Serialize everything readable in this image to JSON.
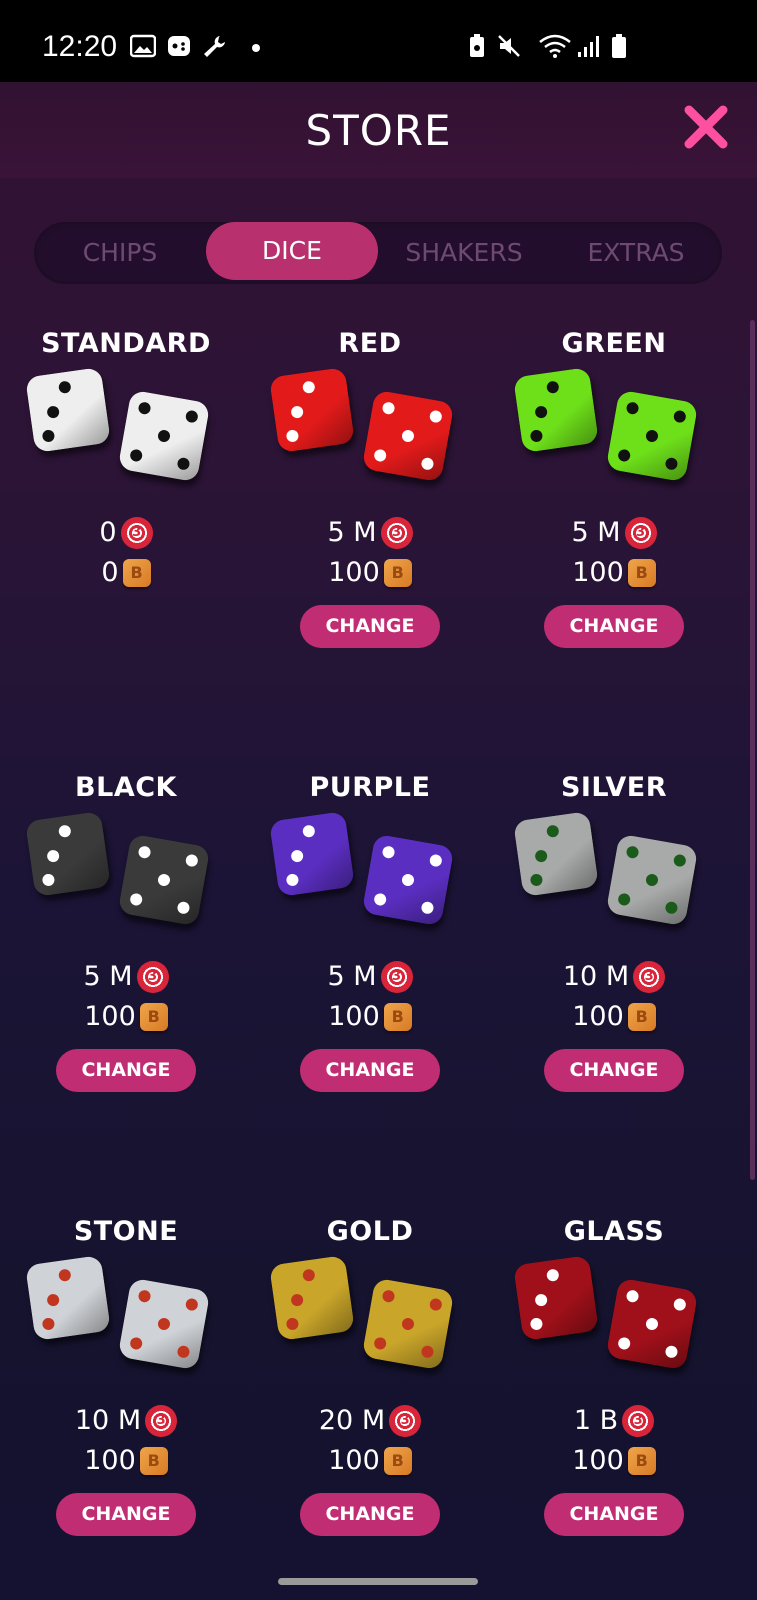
{
  "status_bar": {
    "time": "12:20"
  },
  "header": {
    "title": "STORE"
  },
  "tabs": [
    {
      "label": "CHIPS",
      "active": false
    },
    {
      "label": "DICE",
      "active": true
    },
    {
      "label": "SHAKERS",
      "active": false
    },
    {
      "label": "EXTRAS",
      "active": false
    }
  ],
  "items": [
    {
      "name": "STANDARD",
      "chips": "0",
      "bucks": "0",
      "button": null,
      "color": "#eeeeee",
      "pip": "#111111"
    },
    {
      "name": "RED",
      "chips": "5 M",
      "bucks": "100",
      "button": "CHANGE",
      "color": "#e21a1a",
      "pip": "#ffffff"
    },
    {
      "name": "GREEN",
      "chips": "5 M",
      "bucks": "100",
      "button": "CHANGE",
      "color": "#6ee01a",
      "pip": "#111111"
    },
    {
      "name": "BLACK",
      "chips": "5 M",
      "bucks": "100",
      "button": "CHANGE",
      "color": "#3a3a3a",
      "pip": "#ffffff"
    },
    {
      "name": "PURPLE",
      "chips": "5 M",
      "bucks": "100",
      "button": "CHANGE",
      "color": "#5a2ec0",
      "pip": "#ffffff"
    },
    {
      "name": "SILVER",
      "chips": "10 M",
      "bucks": "100",
      "button": "CHANGE",
      "color": "#a7aaa8",
      "pip": "#1a5a1a"
    },
    {
      "name": "STONE",
      "chips": "10 M",
      "bucks": "100",
      "button": "CHANGE",
      "color": "#cfd2d6",
      "pip": "#c0361e"
    },
    {
      "name": "GOLD",
      "chips": "20 M",
      "bucks": "100",
      "button": "CHANGE",
      "color": "#c9a52a",
      "pip": "#c0361e"
    },
    {
      "name": "GLASS",
      "chips": "1 B",
      "bucks": "100",
      "button": "CHANGE",
      "color": "#a0101a",
      "pip": "#ffffff"
    }
  ]
}
